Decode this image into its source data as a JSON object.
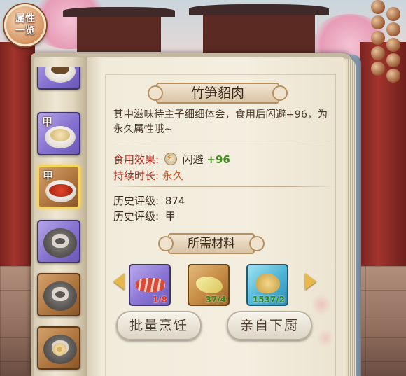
{
  "top_button": {
    "line1": "属性",
    "line2": "一览"
  },
  "dish_list": {
    "slots": [
      {
        "grade": "",
        "state": "dish",
        "color": "purple"
      },
      {
        "grade": "甲",
        "state": "dish",
        "color": "purple"
      },
      {
        "grade": "甲",
        "state": "dish",
        "color": "brown",
        "selected": true
      },
      {
        "grade": "",
        "state": "locked",
        "color": "purple"
      },
      {
        "grade": "",
        "state": "locked",
        "color": "brown"
      },
      {
        "grade": "",
        "state": "locked",
        "color": "brown"
      }
    ]
  },
  "detail": {
    "title": "竹笋貂肉",
    "description": "其中滋味待主子细细体会，食用后闪避+96，为永久属性哦~",
    "effect_label": "食用效果:",
    "effect_icon": "bolt-icon",
    "effect_stat": "闪避",
    "effect_value": "+96",
    "duration_label": "持续时长:",
    "duration_value": "永久",
    "history_rating_label_1": "历史评级:",
    "history_rating_value_1": "874",
    "history_rating_label_2": "历史评级:",
    "history_rating_value_2": "甲"
  },
  "materials": {
    "title": "所需材料",
    "items": [
      {
        "name": "meat",
        "count": "1/8",
        "color": "purple",
        "count_color": "red"
      },
      {
        "name": "bamboo-shoots",
        "count": "37/4",
        "color": "orange",
        "count_color": "green"
      },
      {
        "name": "ginger",
        "count": "1537/2",
        "color": "blue",
        "count_color": "green"
      }
    ]
  },
  "buttons": {
    "batch_cook": "批量烹饪",
    "self_cook": "亲自下厨"
  },
  "colors": {
    "effect_green": "#3e8e1c",
    "duration_orange": "#d0521a",
    "label_red": "#b3281e",
    "selected_border": "#f6d75a"
  }
}
